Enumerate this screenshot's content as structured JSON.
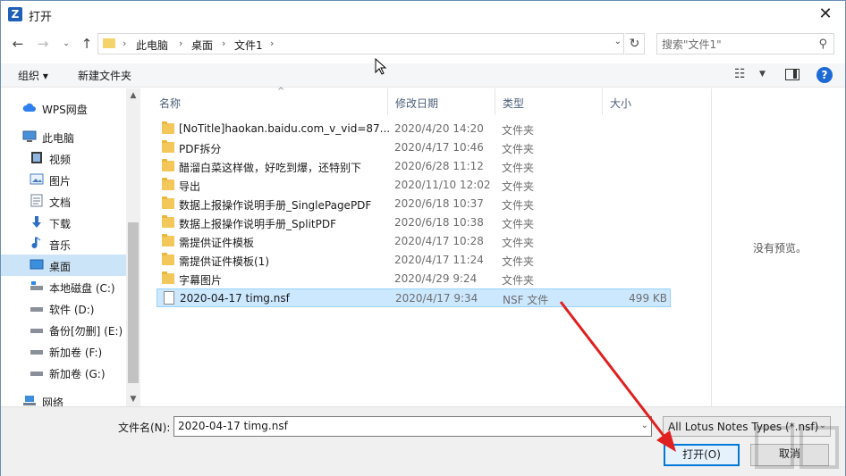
{
  "window": {
    "title": "打开",
    "app_icon_letter": "Z",
    "close_glyph": "✕"
  },
  "address": {
    "crumbs": [
      "此电脑",
      "桌面",
      "文件1"
    ],
    "search_placeholder": "搜索\"文件1\""
  },
  "toolbar": {
    "organize_label": "组织 ▾",
    "new_folder_label": "新建文件夹"
  },
  "nav": {
    "items": [
      {
        "label": "WPS网盘",
        "icon": "cloud-icon"
      },
      {
        "label": "此电脑",
        "icon": "computer-icon"
      },
      {
        "label": "视频",
        "icon": "video-icon"
      },
      {
        "label": "图片",
        "icon": "picture-icon"
      },
      {
        "label": "文档",
        "icon": "document-icon"
      },
      {
        "label": "下载",
        "icon": "download-icon"
      },
      {
        "label": "音乐",
        "icon": "music-icon"
      },
      {
        "label": "桌面",
        "icon": "desktop-icon",
        "selected": true
      },
      {
        "label": "本地磁盘 (C:)",
        "icon": "drive-icon"
      },
      {
        "label": "软件 (D:)",
        "icon": "drive-icon"
      },
      {
        "label": "备份[勿删] (E:)",
        "icon": "drive-icon"
      },
      {
        "label": "新加卷 (F:)",
        "icon": "drive-icon"
      },
      {
        "label": "新加卷 (G:)",
        "icon": "drive-icon"
      },
      {
        "label": "网络",
        "icon": "network-icon"
      }
    ]
  },
  "columns": {
    "name": "名称",
    "date": "修改日期",
    "type": "类型",
    "size": "大小"
  },
  "files": [
    {
      "name": "[NoTitle]haokan.baidu.com_v_vid=87...",
      "date": "2020/4/20 14:20",
      "type": "文件夹",
      "size": "",
      "kind": "folder"
    },
    {
      "name": "PDF拆分",
      "date": "2020/4/17 10:46",
      "type": "文件夹",
      "size": "",
      "kind": "folder"
    },
    {
      "name": "醋溜白菜这样做，好吃到爆，还特别下",
      "date": "2020/6/28 11:12",
      "type": "文件夹",
      "size": "",
      "kind": "folder"
    },
    {
      "name": "导出",
      "date": "2020/11/10 12:02",
      "type": "文件夹",
      "size": "",
      "kind": "folder"
    },
    {
      "name": "数据上报操作说明手册_SinglePagePDF",
      "date": "2020/6/18 10:37",
      "type": "文件夹",
      "size": "",
      "kind": "folder"
    },
    {
      "name": "数据上报操作说明手册_SplitPDF",
      "date": "2020/6/18 10:38",
      "type": "文件夹",
      "size": "",
      "kind": "folder"
    },
    {
      "name": "需提供证件模板",
      "date": "2020/4/17 10:28",
      "type": "文件夹",
      "size": "",
      "kind": "folder"
    },
    {
      "name": "需提供证件模板(1)",
      "date": "2020/4/17 11:24",
      "type": "文件夹",
      "size": "",
      "kind": "folder"
    },
    {
      "name": "字幕图片",
      "date": "2020/4/29 9:24",
      "type": "文件夹",
      "size": "",
      "kind": "folder"
    },
    {
      "name": "2020-04-17 timg.nsf",
      "date": "2020/4/17 9:34",
      "type": "NSF 文件",
      "size": "499 KB",
      "kind": "file",
      "selected": true
    }
  ],
  "preview": {
    "empty_text": "没有预览。"
  },
  "bottom": {
    "filename_label": "文件名(N):",
    "filename_value": "2020-04-17 timg.nsf",
    "filetype_value": "All Lotus Notes Types (*.nsf)",
    "open_label": "打开(O)",
    "cancel_label": "取消"
  },
  "colors": {
    "accent": "#0078d7",
    "selection": "#cce8ff",
    "folder": "#f3c75a",
    "annotation_arrow": "#e02020"
  }
}
